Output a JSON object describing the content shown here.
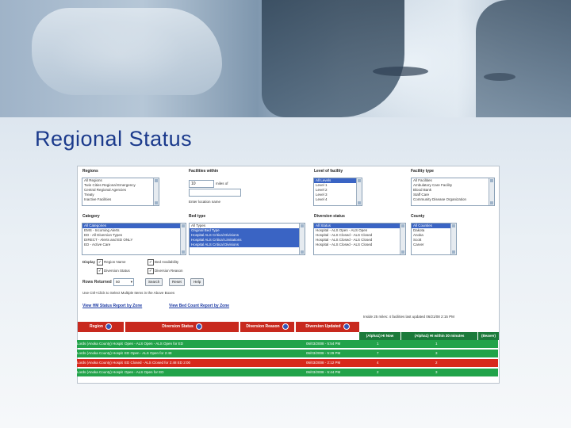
{
  "slide": {
    "title": "Regional Status"
  },
  "form": {
    "regions": {
      "label": "Regions",
      "options": [
        "All Regions",
        "Twin Cities Regional Emergency",
        "Central Regional Agencies",
        "Treaty",
        "Inactive Facilities"
      ]
    },
    "facilities_within": {
      "label": "Facilities within",
      "value": "10",
      "unit": "miles of",
      "hint": "Enter location name"
    },
    "level_of_facility": {
      "label": "Level of facility",
      "options": [
        "All Levels",
        "Level 1",
        "Level 2",
        "Level 3",
        "Level 4"
      ]
    },
    "facility_type": {
      "label": "Facility type",
      "options": [
        "All Facilities",
        "Ambulatory Care Facility",
        "Blood Bank",
        "Staff Care",
        "Community Disease Organization"
      ]
    },
    "category": {
      "label": "Category",
      "options": [
        "All Categories",
        "EMS - Incoming Alerts",
        "ED - All Diversion Types",
        "DIRECT - Alerts and ED ONLY",
        "ED - Active Care"
      ]
    },
    "bed_type": {
      "label": "Bed type",
      "options": [
        "All Types",
        "Original Bed Type",
        "Hospital ALS Critical Divisions",
        "Hospital ALS Critical Limitations",
        "Hospital ALS Critical Divisions"
      ]
    },
    "diversion_status": {
      "label": "Diversion status",
      "options": [
        "All Status",
        "Hospital - ALS Open - ALS Open",
        "Hospital - ALS Closed - ALS Closed",
        "Hospital - ALS Closed - ALS Closed",
        "Hospital - ALS Closed - ALS Closed"
      ]
    },
    "county": {
      "label": "County",
      "options": [
        "All Counties",
        "Dakota",
        "Anoka",
        "Scott",
        "Carver"
      ]
    },
    "display": {
      "label": "Display",
      "options": [
        "Region Name",
        "Bed Availability",
        "Diversion Status",
        "Diversion Reason"
      ]
    },
    "rows_returned": {
      "label": "Rows Returned",
      "value": "50"
    },
    "buttons": {
      "search": "Search",
      "reset": "Reset",
      "help": "Help"
    },
    "hint": "Use Ctrl+Click to Select Multiple Items in the Above Boxes",
    "links": {
      "hospital_status": "View HM Status Report by Zone",
      "bed_count": "View Bed Count Report by Zone"
    }
  },
  "results": {
    "summary": "Inside 25 miles: 4 facilities  last updated 06/21/08 2:15 PM",
    "headers": [
      "Region",
      "Diversion Status",
      "Diversion Reason",
      "Diversion Updated"
    ],
    "subheaders": [
      "(Alpha1) HI Now",
      "(Alpha1) HI within 30 minutes",
      "(Beaver)"
    ],
    "rows": [
      {
        "color": "#22a34a",
        "region": "Lords (Anoka County) Hospital",
        "status": "Open - ALS Open - ALS Open for ED",
        "updated": "06/03/2008 - 5:54 PM",
        "now": "1",
        "within": "1"
      },
      {
        "color": "#22a34a",
        "region": "Lords (Anoka County) Hospital",
        "status": "ED Open - ALS Open for 2:48",
        "updated": "06/03/2008 - 5:29 PM",
        "now": "7",
        "within": "3"
      },
      {
        "color": "#d8281c",
        "region": "Lords (Anoka County) Hospital",
        "status": "ED Closed - ALS Closed for 2:48 ED 2:00",
        "updated": "06/03/2008 - 2:12 PM",
        "now": "4",
        "within": "2"
      },
      {
        "color": "#22a34a",
        "region": "Lords (Anoka County) Hospital",
        "status": "Open - ALS Open for ED",
        "updated": "06/03/2008 - 5:44 PM",
        "now": "2",
        "within": "3"
      }
    ]
  },
  "colors": {
    "accent": "#1b3a8c",
    "header_red": "#c8291e",
    "status_green": "#22a34a",
    "status_red": "#d8281c"
  }
}
